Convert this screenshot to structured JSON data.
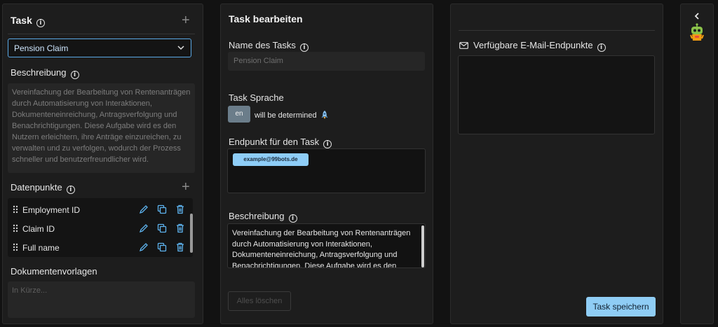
{
  "task_panel": {
    "title": "Task",
    "selected_task": "Pension Claim",
    "description_label": "Beschreibung",
    "description_text": "Vereinfachung der Bearbeitung von Rentenanträgen durch Automatisierung von Interaktionen, Dokumenteneinreichung, Antragsverfolgung und Benachrichtigungen. Diese Aufgabe wird es den Nutzern erleichtern, ihre Anträge einzureichen, zu verwalten und zu verfolgen, wodurch der Prozess schneller und benutzerfreundlicher wird.",
    "datapoints_label": "Datenpunkte",
    "datapoints": [
      {
        "name": "Employment ID"
      },
      {
        "name": "Claim ID"
      },
      {
        "name": "Full name"
      }
    ],
    "templates_label": "Dokumentenvorlagen",
    "templates_placeholder": "In Kürze..."
  },
  "edit_panel": {
    "title": "Task bearbeiten",
    "name_label": "Name des Tasks",
    "name_placeholder": "Pension Claim",
    "language_label": "Task Sprache",
    "language_code": "en",
    "language_status": "will be determined",
    "endpoint_label": "Endpunkt für den Task",
    "endpoint_chip": "example@99bots.de",
    "description_label": "Beschreibung",
    "description_text": "Vereinfachung der Bearbeitung von Rentenanträgen durch Automatisierung von Interaktionen, Dokumenteneinreichung, Antragsverfolgung und Benachrichtigungen. Diese Aufgabe wird es den",
    "delete_all_label": "Alles löschen"
  },
  "email_panel": {
    "title": "Verfügbare E-Mail-Endpunkte",
    "save_label": "Task speichern"
  },
  "colors": {
    "accent": "#5aa9e6",
    "primary_button": "#8fcdf5",
    "icon_blue": "#5eb4f0",
    "panel_bg": "#1d1d1d"
  }
}
